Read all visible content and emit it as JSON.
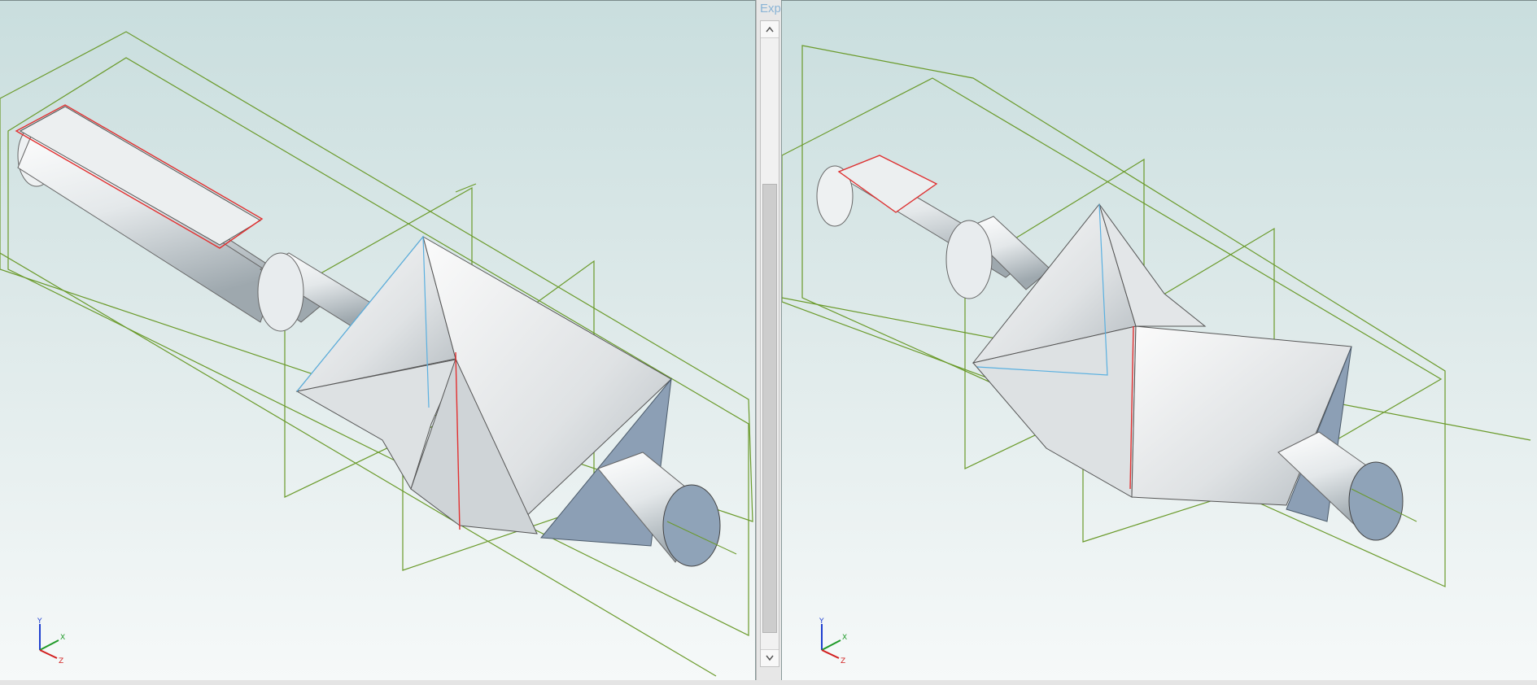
{
  "splitter": {
    "label": "Exp"
  },
  "viewports": {
    "left": {
      "triad_labels": {
        "y": "Y",
        "x": "X",
        "z": "Z"
      }
    },
    "right": {
      "triad_labels": {
        "y": "Y",
        "x": "X",
        "z": "Z"
      }
    }
  },
  "colors": {
    "sketch_planes": "#6a9a2a",
    "highlight_edge": "#e23030",
    "selection_edge": "#5ab0e0",
    "dark_face": "#8c9fb5",
    "axis_x": "#1f9a28",
    "axis_y": "#1f3fd0",
    "axis_z": "#d22020"
  }
}
